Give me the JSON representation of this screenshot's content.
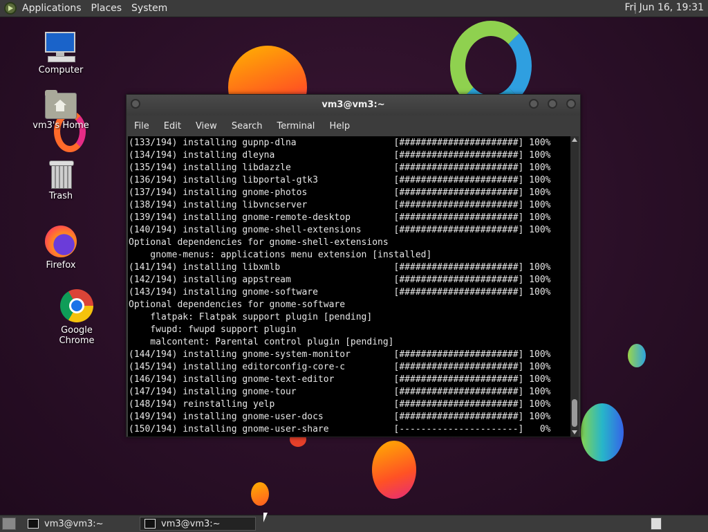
{
  "top_panel": {
    "menus": [
      "Applications",
      "Places",
      "System"
    ],
    "clock": "Fri Jun 16, 19:31"
  },
  "desktop_icons": [
    {
      "label": "Computer",
      "icon": "computer-icon"
    },
    {
      "label": "vm3's Home",
      "icon": "home-folder-icon"
    },
    {
      "label": "Trash",
      "icon": "trash-icon"
    },
    {
      "label": "Firefox",
      "icon": "firefox-icon"
    },
    {
      "label": "Google Chrome",
      "icon": "chrome-icon"
    }
  ],
  "terminal": {
    "title": "vm3@vm3:~",
    "menu": [
      "File",
      "Edit",
      "View",
      "Search",
      "Terminal",
      "Help"
    ],
    "lines": [
      "(133/194) installing gupnp-dlna                  [######################] 100%",
      "(134/194) installing dleyna                      [######################] 100%",
      "(135/194) installing libdazzle                   [######################] 100%",
      "(136/194) installing libportal-gtk3              [######################] 100%",
      "(137/194) installing gnome-photos                [######################] 100%",
      "(138/194) installing libvncserver                [######################] 100%",
      "(139/194) installing gnome-remote-desktop        [######################] 100%",
      "(140/194) installing gnome-shell-extensions      [######################] 100%",
      "Optional dependencies for gnome-shell-extensions",
      "    gnome-menus: applications menu extension [installed]",
      "(141/194) installing libxmlb                     [######################] 100%",
      "(142/194) installing appstream                   [######################] 100%",
      "(143/194) installing gnome-software              [######################] 100%",
      "Optional dependencies for gnome-software",
      "    flatpak: Flatpak support plugin [pending]",
      "    fwupd: fwupd support plugin",
      "    malcontent: Parental control plugin [pending]",
      "(144/194) installing gnome-system-monitor        [######################] 100%",
      "(145/194) installing editorconfig-core-c         [######################] 100%",
      "(146/194) installing gnome-text-editor           [######################] 100%",
      "(147/194) installing gnome-tour                  [######################] 100%",
      "(148/194) reinstalling yelp                      [######################] 100%",
      "(149/194) installing gnome-user-docs             [######################] 100%",
      "(150/194) installing gnome-user-share            [----------------------]   0%"
    ]
  },
  "taskbar": {
    "tasks": [
      "vm3@vm3:~",
      "vm3@vm3:~"
    ]
  },
  "colors": {
    "panel": "#3b3b3b",
    "terminal_bg": "#000000",
    "terminal_fg": "#e6e6e6"
  }
}
